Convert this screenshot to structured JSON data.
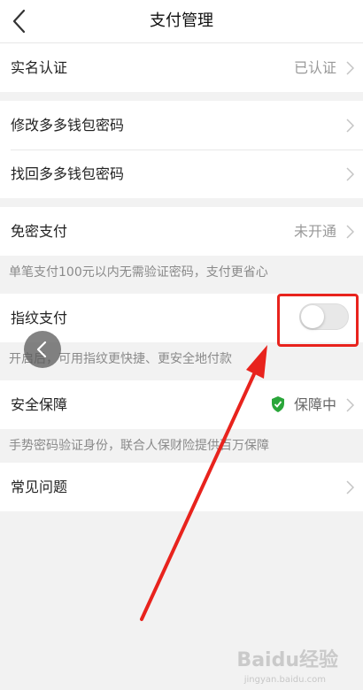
{
  "header": {
    "title": "支付管理",
    "back_icon": "chevron-left-icon"
  },
  "rows": {
    "real_name": {
      "label": "实名认证",
      "value": "已认证"
    },
    "change_password": {
      "label": "修改多多钱包密码"
    },
    "retrieve_password": {
      "label": "找回多多钱包密码"
    },
    "password_free": {
      "label": "免密支付",
      "value": "未开通",
      "hint": "单笔支付100元以内无需验证密码，支付更省心"
    },
    "fingerprint": {
      "label": "指纹支付",
      "hint": "开启后，可用指纹更快捷、更安全地付款",
      "enabled": false
    },
    "security": {
      "label": "安全保障",
      "value": "保障中",
      "hint": "手势密码验证身份，联合人保财险提供百万保障"
    },
    "faq": {
      "label": "常见问题"
    }
  },
  "annotations": {
    "highlight_color": "#e8231d"
  },
  "watermark": {
    "text": "Baidu经验",
    "sub": "jingyan.baidu.com"
  }
}
